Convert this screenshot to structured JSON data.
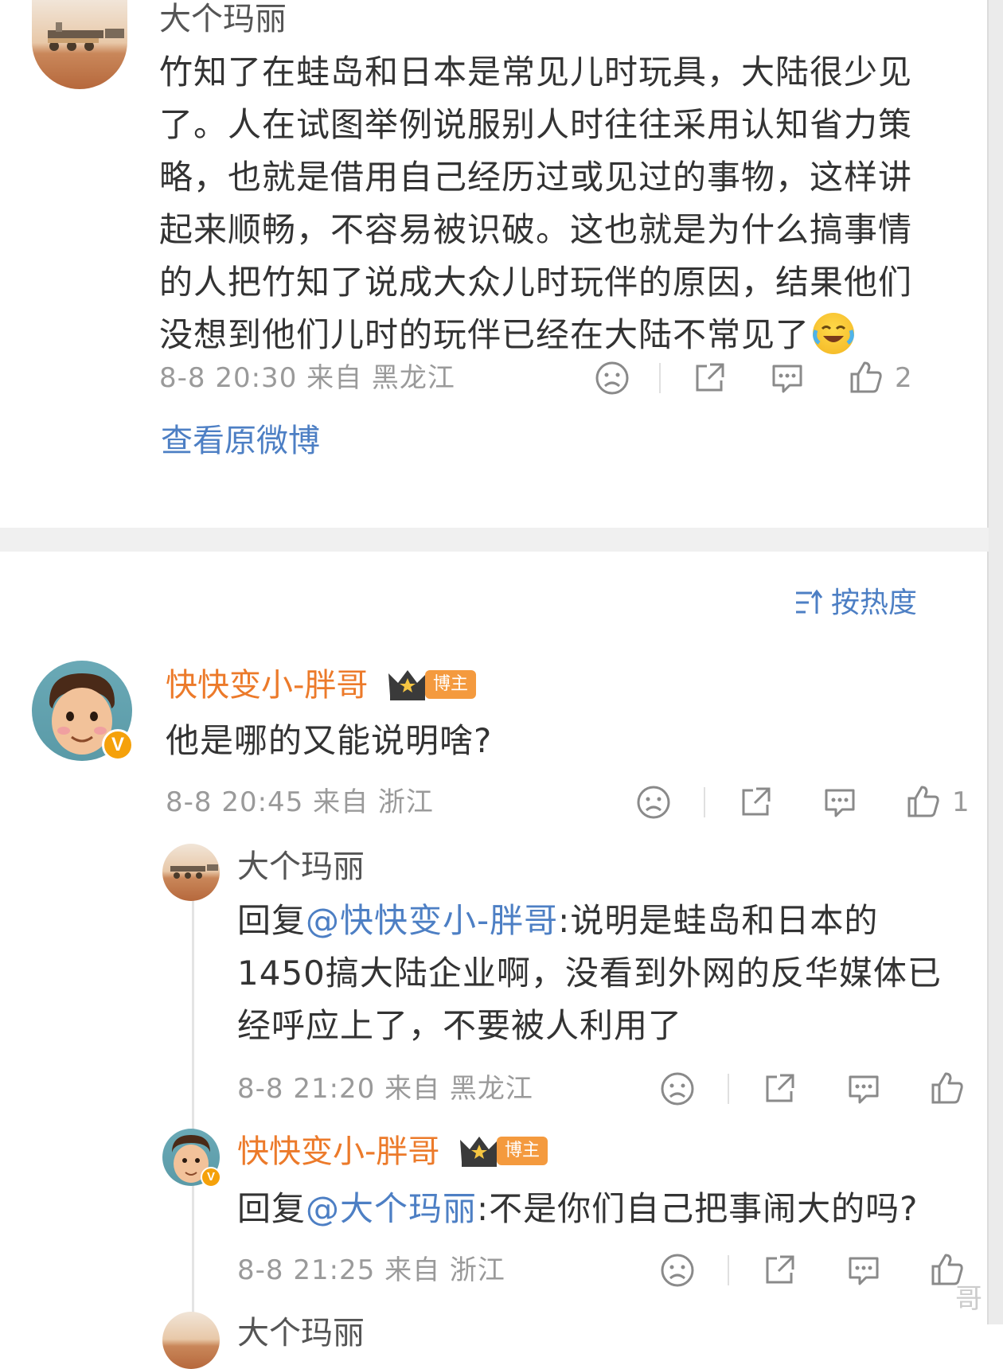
{
  "post": {
    "username": "大个玛丽",
    "lines": [
      "竹知了在蛙岛和日本是常见儿时玩具，大陆很少见",
      "了。人在试图举例说服别人时往往采用认知省力策",
      "略，也就是借用自己经历过或见过的事物，这样讲",
      "起来顺畅，不容易被识破。这也就是为什么搞事情",
      "的人把竹知了说成大众儿时玩伴的原因，结果他们",
      "没想到他们儿时的玩伴已经在大陆不常见了"
    ],
    "emoji_icon": "laugh-cry-emoji",
    "meta": "8-8 20:30 来自 黑龙江",
    "like_count": "2",
    "view_original": "查看原微博"
  },
  "sort_label": "按热度",
  "comments": [
    {
      "username": "快快变小-胖哥",
      "badge": "博主",
      "text": "他是哪的又能说明啥?",
      "meta": "8-8 20:45 来自 浙江",
      "like_count": "1",
      "verified_mark": "V"
    }
  ],
  "replies": [
    {
      "username": "大个玛丽",
      "prefix": "回复",
      "mention": "@快快变小-胖哥",
      "lines": [
        ":说明是蛙岛和日本的",
        "1450搞大陆企业啊，没看到外网的反华媒体已",
        "经呼应上了，不要被人利用了"
      ],
      "meta": "8-8 21:20 来自 黑龙江"
    },
    {
      "username": "快快变小-胖哥",
      "badge": "博主",
      "prefix": "回复",
      "mention": "@大个玛丽",
      "text": ":不是你们自己把事闹大的吗?",
      "meta": "8-8 21:25 来自 浙江",
      "verified_mark": "V"
    }
  ],
  "next_reply_username": "大个玛丽",
  "watermark": "哥",
  "colors": {
    "accent_blue": "#4d7fc4",
    "username_orange": "#ec7a2a",
    "meta_gray": "#9a9a9a",
    "badge_orange": "#f49a3e",
    "verified_yellow": "#f5a10a"
  },
  "icons": [
    "sad-face-icon",
    "share-icon",
    "comment-icon",
    "thumbs-up-icon",
    "sort-icon",
    "crown-icon"
  ]
}
